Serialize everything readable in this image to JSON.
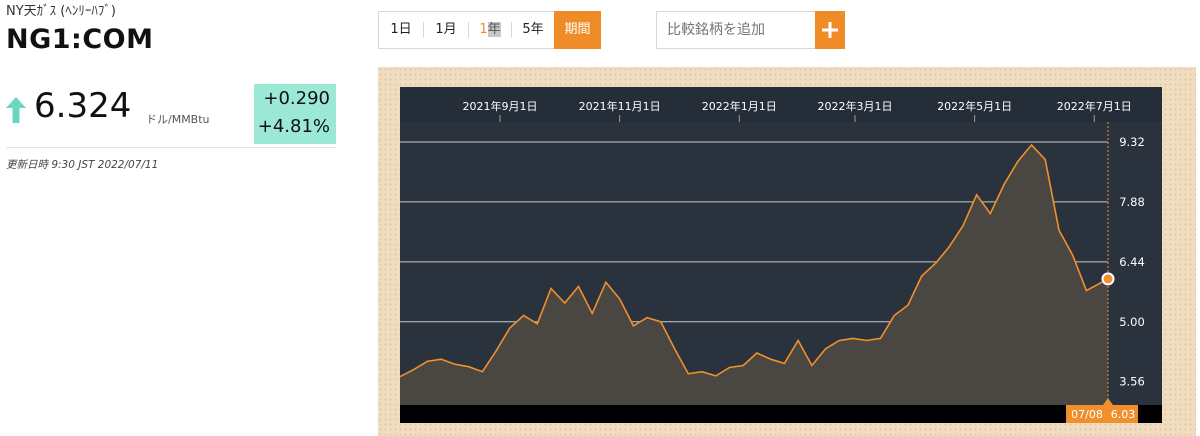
{
  "header": {
    "subtitle": "NY天ｶﾞｽ (ﾍﾝﾘｰﾊﾌﾞ)",
    "symbol": "NG1:COM",
    "price": "6.324",
    "unit": "ドル/MMBtu",
    "change_abs": "+0.290",
    "change_pct": "+4.81%",
    "updated": "更新日時 9:30 JST 2022/07/11"
  },
  "range": {
    "day": "1日",
    "month": "1月",
    "year_a": "1",
    "year_b": "年",
    "five": "5年",
    "period": "期間"
  },
  "compare": {
    "placeholder": "比較銘柄を追加"
  },
  "colors": {
    "accent": "#f08c28",
    "chart_bg": "#2a323e",
    "change_bg": "#9be8d6",
    "arrow": "#6cd5bf"
  },
  "chart_data": {
    "type": "area",
    "title": "",
    "xlabel": "",
    "ylabel": "",
    "ylim": [
      3.0,
      9.8
    ],
    "y_ticks": [
      "9.32",
      "7.88",
      "6.44",
      "5.00",
      "3.56"
    ],
    "x_ticks": [
      "2021年9月1日",
      "2021年11月1日",
      "2022年1月1日",
      "2022年3月1日",
      "2022年5月1日",
      "2022年7月1日"
    ],
    "grid": true,
    "x_start": "2021-07-12",
    "x_end": "2022-07-08",
    "current_date_label": "07/08",
    "current_value_label": "6.03",
    "current_value": 6.03,
    "series": [
      {
        "name": "",
        "x": [
          "2021-07-12",
          "2021-07-19",
          "2021-07-26",
          "2021-08-02",
          "2021-08-09",
          "2021-08-16",
          "2021-08-23",
          "2021-08-30",
          "2021-09-06",
          "2021-09-13",
          "2021-09-20",
          "2021-09-27",
          "2021-10-04",
          "2021-10-11",
          "2021-10-18",
          "2021-10-25",
          "2021-11-01",
          "2021-11-08",
          "2021-11-15",
          "2021-11-22",
          "2021-11-29",
          "2021-12-06",
          "2021-12-13",
          "2021-12-20",
          "2021-12-27",
          "2022-01-03",
          "2022-01-10",
          "2022-01-17",
          "2022-01-24",
          "2022-01-31",
          "2022-02-07",
          "2022-02-14",
          "2022-02-21",
          "2022-02-28",
          "2022-03-07",
          "2022-03-14",
          "2022-03-21",
          "2022-03-28",
          "2022-04-04",
          "2022-04-11",
          "2022-04-18",
          "2022-04-25",
          "2022-05-02",
          "2022-05-09",
          "2022-05-16",
          "2022-05-23",
          "2022-05-30",
          "2022-06-06",
          "2022-06-13",
          "2022-06-20",
          "2022-06-27",
          "2022-07-08"
        ],
        "values": [
          3.68,
          3.85,
          4.05,
          4.1,
          3.98,
          3.92,
          3.8,
          4.3,
          4.85,
          5.15,
          4.95,
          5.8,
          5.45,
          5.85,
          5.2,
          5.95,
          5.55,
          4.9,
          5.1,
          5.0,
          4.35,
          3.75,
          3.8,
          3.7,
          3.9,
          3.95,
          4.25,
          4.1,
          4.0,
          4.55,
          3.95,
          4.35,
          4.55,
          4.6,
          4.55,
          4.6,
          5.15,
          5.4,
          6.1,
          6.4,
          6.8,
          7.3,
          8.05,
          7.6,
          8.3,
          8.85,
          9.25,
          8.9,
          7.2,
          6.6,
          5.75,
          6.03
        ]
      }
    ]
  }
}
